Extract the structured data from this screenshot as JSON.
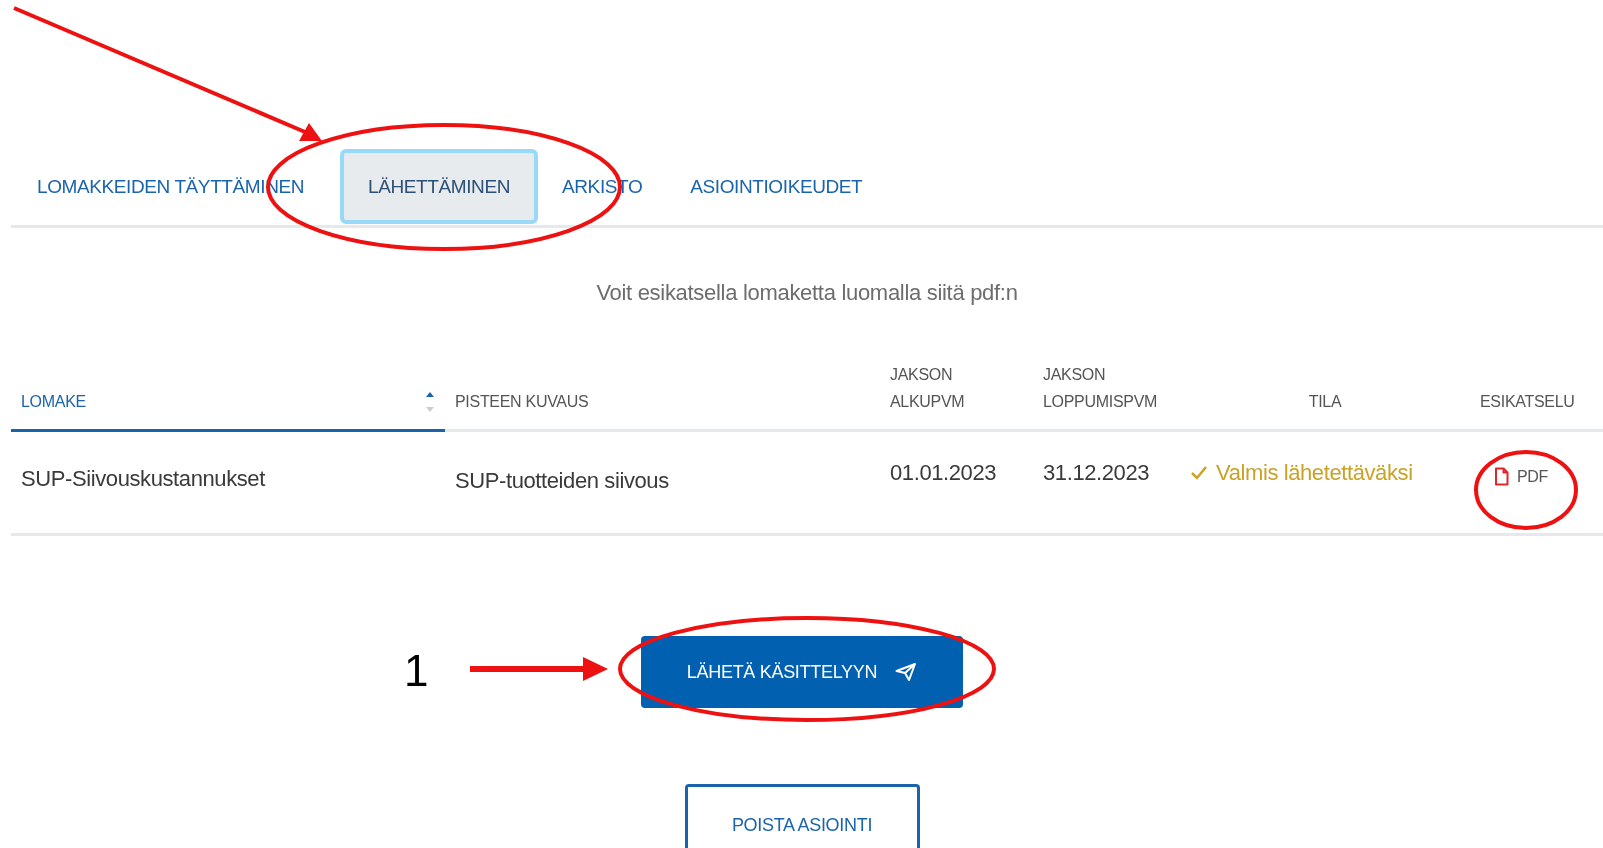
{
  "tabs": [
    {
      "label": "LOMAKKEIDEN TÄYTTÄMINEN",
      "selected": false
    },
    {
      "label": "LÄHETTÄMINEN",
      "selected": true
    },
    {
      "label": "ARKISTO",
      "selected": false
    },
    {
      "label": "ASIOINTIOIKEUDET",
      "selected": false
    }
  ],
  "info_text": "Voit esikatsella lomaketta luomalla siitä pdf:n",
  "table": {
    "columns": [
      {
        "label": "LOMAKE",
        "sorted": true
      },
      {
        "label": "PISTEEN KUVAUS",
        "sorted": false
      },
      {
        "label": "JAKSON ALKUPVM",
        "sorted": false
      },
      {
        "label": "JAKSON LOPPUMISPVM",
        "sorted": false
      },
      {
        "label": "TILA",
        "sorted": false
      },
      {
        "label": "ESIKATSELU",
        "sorted": false
      }
    ],
    "rows": [
      {
        "lomake": "SUP-Siivouskustannukset",
        "pisteen_kuvaus": "SUP-tuotteiden siivous",
        "alkupvm": "01.01.2023",
        "loppumispvm": "31.12.2023",
        "tila": "Valmis lähetettäväksi",
        "esikatselu": "PDF"
      }
    ]
  },
  "buttons": [
    {
      "label": "LÄHETÄ KÄSITTELYYN",
      "kind": "primary"
    },
    {
      "label": "POISTA ASIOINTI",
      "kind": "outline"
    }
  ],
  "annotations": {
    "step_number": "1"
  }
}
